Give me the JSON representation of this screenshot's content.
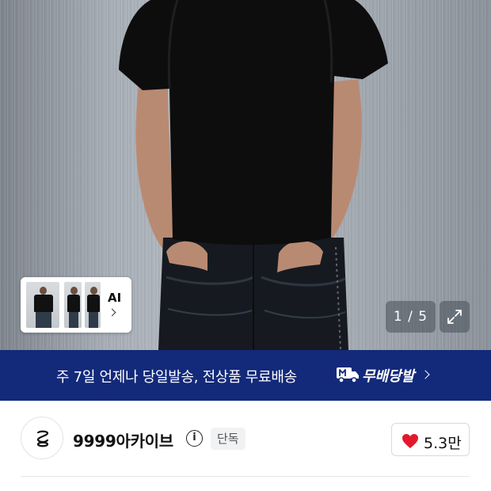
{
  "product_image": {
    "alt": "model wearing black t-shirt and dark jeans",
    "ai_button_label": "AI",
    "counter_text": "1 / 5"
  },
  "banner": {
    "text": "주 7일 언제나 당일발송, 전상품 무료배송",
    "brand": "무배당발",
    "icon": "truck-icon"
  },
  "brand": {
    "name": "9999아카이브",
    "badge": "단독",
    "like_count": "5.3만"
  },
  "colors": {
    "banner_bg": "#13297a",
    "heart": "#e3192b"
  }
}
